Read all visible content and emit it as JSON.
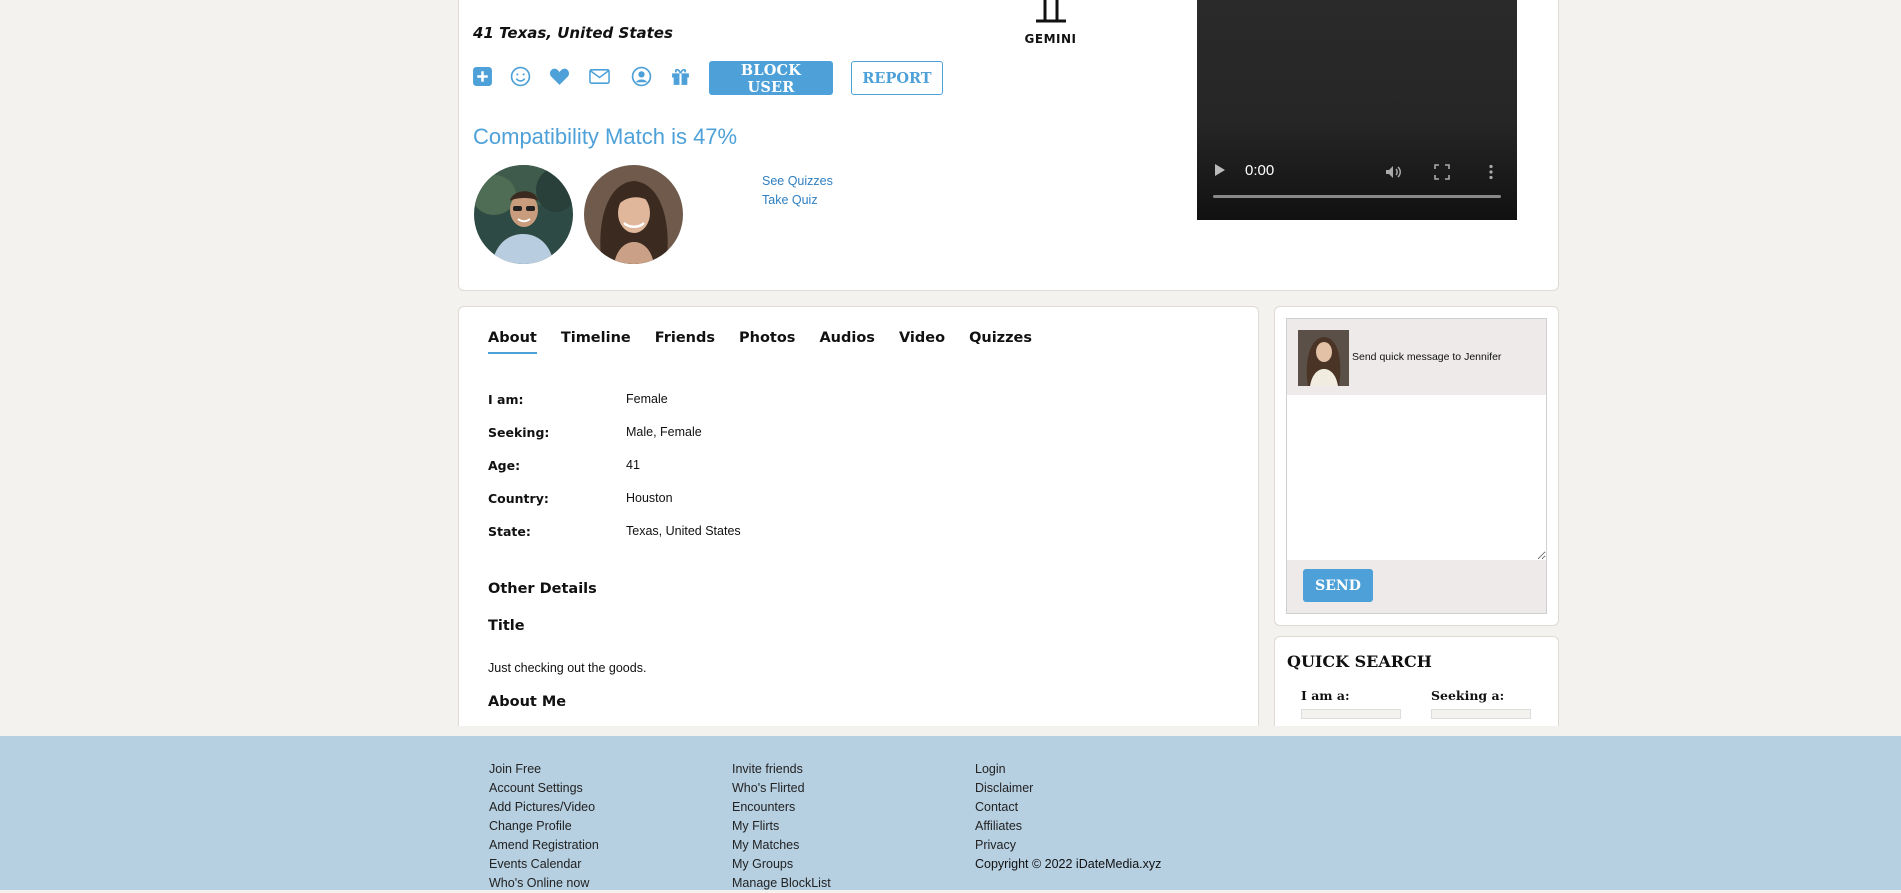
{
  "profile": {
    "location_line": "41 Texas, United States",
    "zodiac": {
      "symbol": "♊",
      "label": "GEMINI"
    }
  },
  "actions": {
    "icons": [
      "add-icon",
      "smile-icon",
      "heart-icon",
      "mail-icon",
      "profile-icon",
      "gift-icon"
    ],
    "block_label": "BLOCK USER",
    "report_label": "REPORT"
  },
  "compatibility": {
    "text": "Compatibility Match is 47%",
    "see_quizzes": "See Quizzes",
    "take_quiz": "Take Quiz"
  },
  "video": {
    "time": "0:00"
  },
  "tabs": [
    "About",
    "Timeline",
    "Friends",
    "Photos",
    "Audios",
    "Video",
    "Quizzes"
  ],
  "about": {
    "rows": [
      {
        "label": "I am:",
        "value": "Female"
      },
      {
        "label": "Seeking:",
        "value": "Male, Female"
      },
      {
        "label": "Age:",
        "value": "41"
      },
      {
        "label": "Country:",
        "value": "Houston"
      },
      {
        "label": "State:",
        "value": "Texas, United States"
      }
    ],
    "other_details": "Other Details",
    "title_heading": "Title",
    "title_text": "Just checking out the goods.",
    "about_me_heading": "About Me"
  },
  "quick_message": {
    "label": "Send quick message to  Jennifer",
    "send_label": "SEND"
  },
  "quick_search": {
    "title": "QUICK SEARCH",
    "i_am_label": "I am a:",
    "seeking_label": "Seeking a:"
  },
  "footer": {
    "col1": [
      "Join Free",
      "Account Settings",
      "Add Pictures/Video",
      "Change Profile",
      "Amend Registration",
      "Events Calendar",
      "Who's Online now"
    ],
    "col2": [
      "Invite friends",
      "Who's Flirted",
      "Encounters",
      "My Flirts",
      "My Matches",
      "My Groups",
      "Manage BlockList"
    ],
    "col3": [
      "Login",
      "Disclaimer",
      "Contact",
      "Affiliates",
      "Privacy"
    ],
    "copyright": "Copyright © 2022 iDateMedia.xyz"
  },
  "colors": {
    "accent": "#4da1d8",
    "footer_bg": "#b6cfe1",
    "page_bg": "#f3f2ef"
  }
}
